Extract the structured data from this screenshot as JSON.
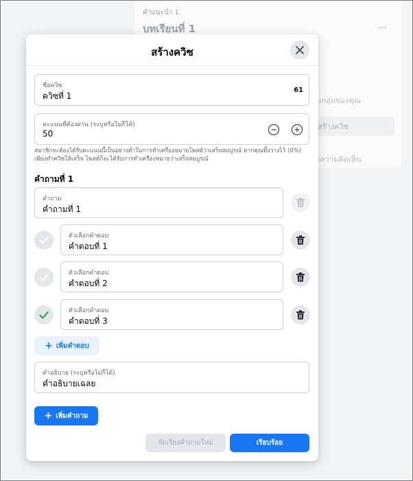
{
  "background": {
    "subtitle": "คำแนะนำ 1",
    "title": "บทเรียนที่ 1",
    "more_icon": "…",
    "line1": "มกลุ่มของคุณ",
    "create_button": "สร้างควิซ",
    "line2": "งความคิดเห็น"
  },
  "modal": {
    "title": "สร้างควิซ",
    "close_icon": "close-icon"
  },
  "quiz_name": {
    "label": "ชื่อควิซ",
    "value": "ควิซที่ 1",
    "counter": "61"
  },
  "pass_score": {
    "label": "คะแนนที่ต้องผ่าน (ระบุหรือไม่ก็ได้)",
    "value": "50",
    "decrement_icon": "minus-circle-icon",
    "increment_icon": "plus-circle-icon"
  },
  "helper_text": "สมาชิกจะต้องได้รับคะแนนนี้เป็นอย่างต่ำในการทำเครื่องหมายโพสต์ว่าเสร็จสมบูรณ์ หากคุณทิ้งว่างไว้ (0%) เพียงทำควิซให้เสร็จ โพสต์ก็จะได้รับการทำเครื่องหมายว่าเสร็จสมบูรณ์",
  "question_section_title": "คำถามที่ 1",
  "question": {
    "label": "คำถาม",
    "value": "คำถามที่ 1"
  },
  "answers": [
    {
      "label": "ตัวเลือกคำตอบ",
      "value": "คำตอบที่ 1",
      "correct": false
    },
    {
      "label": "ตัวเลือกคำตอบ",
      "value": "คำตอบที่ 2",
      "correct": false
    },
    {
      "label": "ตัวเลือกคำตอบ",
      "value": "คำตอบที่ 3",
      "correct": true
    }
  ],
  "add_answer_label": "เพิ่มคำตอบ",
  "explanation": {
    "label": "คำอธิบาย (ระบุหรือไม่ก็ได้)",
    "value": "คำอธิบายเฉลย"
  },
  "add_question_label": "เพิ่มคำถาม",
  "footer": {
    "reorder_label": "จัดเรียงคำถามใหม่",
    "done_label": "เรียบร้อย"
  },
  "colors": {
    "accent": "#1877f2",
    "correct_check": "#31a24c"
  }
}
